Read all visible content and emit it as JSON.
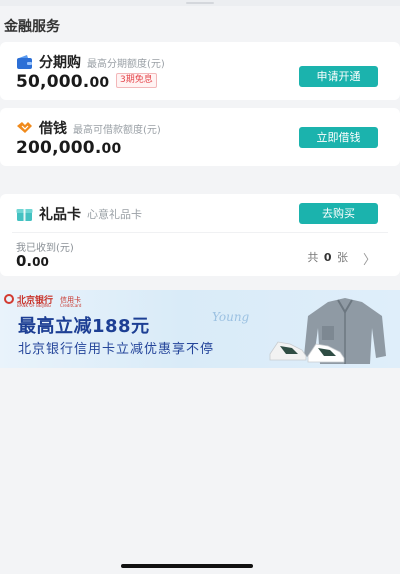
{
  "section": {
    "title": "金融服务"
  },
  "fenqi": {
    "icon": "wallet-icon",
    "name": "分期购",
    "desc": "最高分期额度(元)",
    "amount_main": "50,000.",
    "amount_cents": "00",
    "badge": "3期免息",
    "button": "申请开通"
  },
  "jieqian": {
    "icon": "handshake-icon",
    "name": "借钱",
    "desc": "最高可借款额度(元)",
    "amount_main": "200,000.",
    "amount_cents": "00",
    "button": "立即借钱"
  },
  "gift": {
    "icon": "gift-box-icon",
    "name": "礼品卡",
    "desc": "心意礼品卡",
    "button": "去购买",
    "received_label": "我已收到(元)",
    "received_main": "0.",
    "received_cents": "00",
    "count_prefix": "共",
    "count_value": "0",
    "count_suffix": "张",
    "chevron": "〉"
  },
  "banner": {
    "bank_name": "北京银行",
    "bank_name_en": "BANK OF BEIJING",
    "card_label": "信用卡",
    "card_label_en": "CreditCard",
    "headline": "最高立减188元",
    "subline": "北京银行信用卡立减优惠享不停",
    "script": "Young"
  },
  "colors": {
    "accent": "#1bb3ad",
    "badge_red": "#e5484d",
    "banner_blue": "#1d3f94",
    "bank_red": "#c8332a"
  }
}
